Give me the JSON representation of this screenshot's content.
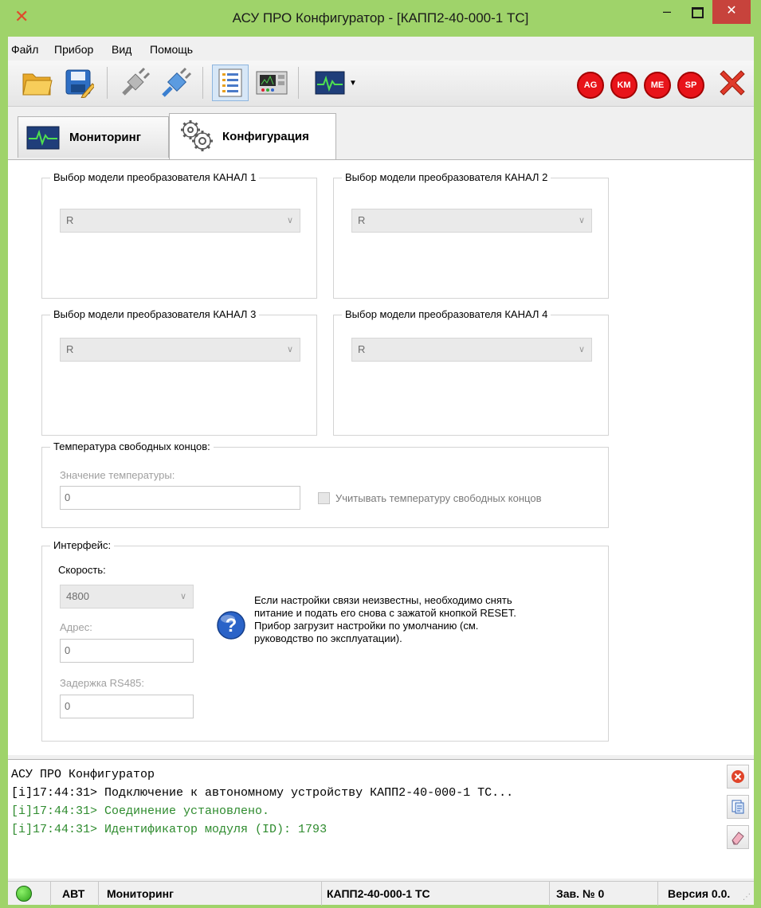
{
  "window": {
    "title": "АСУ ПРО Конфигуратор - [КАПП2-40-000-1 ТС]",
    "min_glyph": "–",
    "close_glyph": "✕"
  },
  "menu": [
    "Файл",
    "Прибор",
    "Вид",
    "Помощь"
  ],
  "toolbar": {
    "buttons": [
      "open-folder-icon",
      "save-edit-icon",
      "disconnect-plug-icon",
      "connect-plug-icon",
      "config-list-icon",
      "device-panel-icon",
      "monitoring-graph-icon"
    ],
    "status_indicators": [
      "AG",
      "KM",
      "ME",
      "SP"
    ],
    "accent_red": "#e8141a"
  },
  "tabs": [
    {
      "label": "Мониторинг",
      "icon": "monitoring-icon",
      "active": false
    },
    {
      "label": "Конфигурация",
      "icon": "gears-icon",
      "active": true
    }
  ],
  "channels": [
    {
      "title": "Выбор модели преобразователя  КАНАЛ 1",
      "value": "R"
    },
    {
      "title": "Выбор модели преобразователя  КАНАЛ 2",
      "value": "R"
    },
    {
      "title": "Выбор модели преобразователя  КАНАЛ 3",
      "value": "R"
    },
    {
      "title": "Выбор модели преобразователя  КАНАЛ 4",
      "value": "R"
    }
  ],
  "cold_junction": {
    "title": "Температура свободных концов:",
    "value_label": "Значение температуры:",
    "value": "0",
    "checkbox_label": "Учитывать температуру свободных концов"
  },
  "interface": {
    "title": "Интерфейс:",
    "speed_label": "Скорость:",
    "speed_value": "4800",
    "address_label": "Адрес:",
    "address_value": "0",
    "delay_label": "Задержка RS485:",
    "delay_value": "0",
    "help_text_1": "Если настройки связи неизвестны, необходимо снять",
    "help_text_2": "питание и подать его снова с зажатой кнопкой RESET.",
    "help_text_3": "Прибор загрузит настройки по умолчанию (см.",
    "help_text_4": "руководство по эксплуатации)."
  },
  "log": [
    {
      "text": "АСУ ПРО Конфигуратор",
      "color": "#000000"
    },
    {
      "text": "[i]17:44:31> Подключение к автономному устройству КАПП2-40-000-1 ТС...",
      "color": "#000000"
    },
    {
      "text": "[i]17:44:31> Соединение установлено.",
      "color": "#2e8b2e"
    },
    {
      "text": "[i]17:44:31> Идентификатор модуля (ID): 1793",
      "color": "#2e8b2e"
    }
  ],
  "statusbar": {
    "mode": "АВТ",
    "view": "Мониторинг",
    "device": "КАПП2-40-000-1 ТС",
    "serial": "Зав. № 0",
    "version": "Версия 0.0."
  }
}
